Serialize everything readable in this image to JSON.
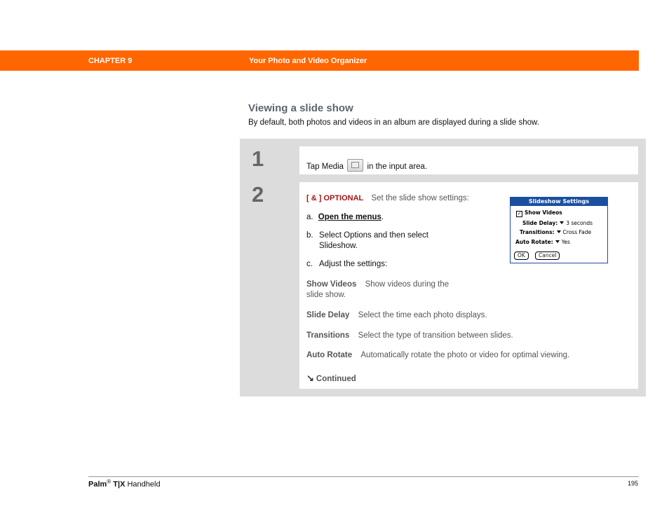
{
  "header": {
    "chapter": "CHAPTER 9",
    "title": "Your Photo and Video Organizer",
    "accent_color": "#ff6600"
  },
  "section": {
    "title": "Viewing a slide show",
    "intro": "By default, both photos and videos in an album are displayed during a slide show."
  },
  "step1": {
    "number": "1",
    "text_before": "Tap Media",
    "icon": "media-icon",
    "text_after": "in the input area."
  },
  "step2": {
    "number": "2",
    "optional_tag": "[ & ]  OPTIONAL",
    "lead": "Set the slide show settings:",
    "a_prefix": "a.",
    "a_link": "Open the menus",
    "a_suffix": ".",
    "b_prefix": "b.",
    "b_text_line1": "Select Options and then select",
    "b_text_line2": "Slideshow.",
    "c_prefix": "c.",
    "c_text": "Adjust the settings:",
    "settings": [
      {
        "term": "Show Videos",
        "desc_line1": "Show videos during the",
        "desc_line2": "slide show."
      },
      {
        "term": "Slide Delay",
        "desc_line1": "Select the time each photo displays."
      },
      {
        "term": "Transitions",
        "desc_line1": "Select the type of transition between slides."
      },
      {
        "term": "Auto Rotate",
        "desc_line1": "Automatically rotate the photo or video for optimal viewing."
      }
    ],
    "continued": "Continued"
  },
  "dialog": {
    "title": "Slideshow Settings",
    "show_videos": "Show Videos",
    "slide_delay_label": "Slide Delay:",
    "slide_delay_value": "3 seconds",
    "transitions_label": "Transitions:",
    "transitions_value": "Cross Fade",
    "auto_rotate_label": "Auto Rotate:",
    "auto_rotate_value": "Yes",
    "ok": "OK",
    "cancel": "Cancel",
    "title_color": "#1a4fa0"
  },
  "footer": {
    "brand": "Palm",
    "reg": "®",
    "model": "T|X",
    "product": "Handheld",
    "page": "195"
  }
}
